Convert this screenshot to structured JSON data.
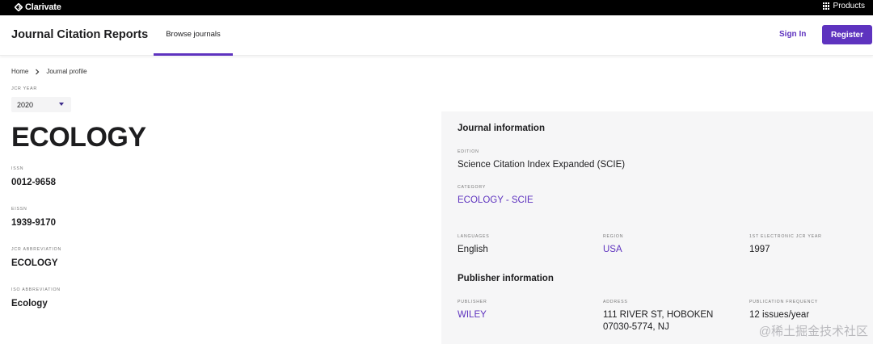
{
  "topbar": {
    "brand": "Clarivate",
    "brand_icon": "clarivate-logo-icon",
    "products_icon": "grid-icon",
    "products_label": "Products"
  },
  "header": {
    "title": "Journal Citation Reports",
    "nav_tab": "Browse journals",
    "sign_in": "Sign In",
    "register": "Register",
    "accent_color": "#5e33bf"
  },
  "breadcrumb": {
    "home": "Home",
    "separator_icon": "chevron-right-icon",
    "current": "Journal profile"
  },
  "jcr_year": {
    "label": "JCR YEAR",
    "value": "2020"
  },
  "journal": {
    "title": "ECOLOGY",
    "issn_label": "ISSN",
    "issn": "0012-9658",
    "eissn_label": "EISSN",
    "eissn": "1939-9170",
    "jcr_abbrev_label": "JCR ABBREVIATION",
    "jcr_abbrev": "ECOLOGY",
    "iso_abbrev_label": "ISO ABBREVIATION",
    "iso_abbrev": "Ecology"
  },
  "journal_info": {
    "heading": "Journal information",
    "edition_label": "EDITION",
    "edition": "Science Citation Index Expanded (SCIE)",
    "category_label": "CATEGORY",
    "category": "ECOLOGY - SCIE",
    "languages_label": "LANGUAGES",
    "languages": "English",
    "region_label": "REGION",
    "region": "USA",
    "first_year_label": "1ST ELECTRONIC JCR YEAR",
    "first_year": "1997"
  },
  "publisher_info": {
    "heading": "Publisher information",
    "publisher_label": "PUBLISHER",
    "publisher": "WILEY",
    "address_label": "ADDRESS",
    "address_line1": "111 RIVER ST, HOBOKEN",
    "address_line2": "07030-5774, NJ",
    "frequency_label": "PUBLICATION FREQUENCY",
    "frequency": "12 issues/year"
  },
  "watermark": "@稀土掘金技术社区"
}
